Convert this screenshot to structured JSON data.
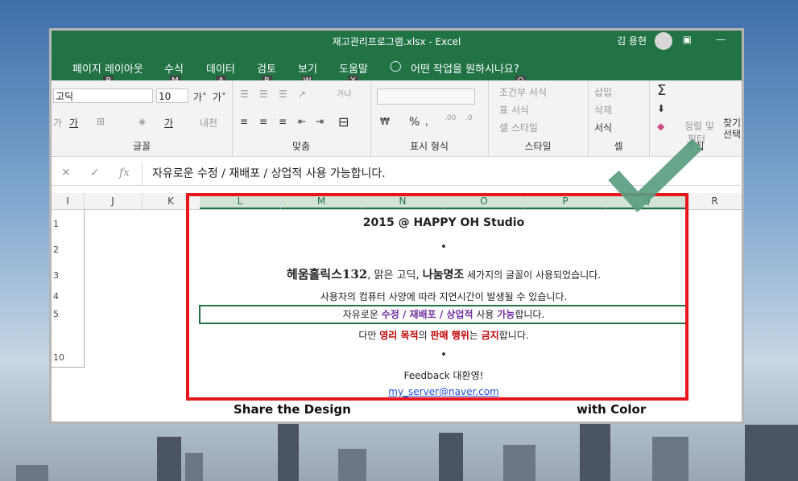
{
  "window": {
    "title": "재고관리프로그램.xlsx  -  Excel",
    "user": "김 용현"
  },
  "menu": [
    {
      "label": "페이지 레이아웃",
      "key": "P"
    },
    {
      "label": "수식",
      "key": "M"
    },
    {
      "label": "데이터",
      "key": "A"
    },
    {
      "label": "검토",
      "key": "R"
    },
    {
      "label": "보기",
      "key": "W"
    },
    {
      "label": "도움말",
      "key": "Y"
    }
  ],
  "tellme": {
    "label": "어떤 작업을 원하시나요?",
    "key": "Q"
  },
  "ribbon": {
    "font_name": "고딕",
    "font_size": "10",
    "groups": {
      "font": "글꼴",
      "alignment": "맞춤",
      "number": "표시 형식",
      "styles": "스타일",
      "cells": "셀",
      "editing": "편집"
    },
    "styles_items": [
      "조건부 서식",
      "표 서식",
      "셀 스타일"
    ],
    "cells_items": [
      "삽입",
      "삭제",
      "서식"
    ],
    "editing_items": [
      "정렬 및",
      "필터",
      "찾기",
      "선택"
    ],
    "percent": "%"
  },
  "formula_bar": {
    "fx": "fx",
    "content": "자유로운 수정 / 재배포 / 상업적 사용 가능합니다."
  },
  "columns": [
    "I",
    "J",
    "K",
    "L",
    "M",
    "N",
    "O",
    "P",
    "Q",
    "R"
  ],
  "rows": [
    "1",
    "2",
    "3",
    "4",
    "5",
    "10"
  ],
  "sheet": {
    "line1": "2015 @ HAPPY OH Studio",
    "bullet": "•",
    "line3_part1": "헤움홀릭스132",
    "line3_part2": ", 맑은 고딕, ",
    "line3_part3": "나눔명조",
    "line3_part4": " 세가지의 글꼴이 사용되었습니다.",
    "line4": "사용자의 컴퓨터 사양에 따라 지연시간이 발생될 수 있습니다.",
    "line5": [
      {
        "text": "자유로운 ",
        "style": "normal"
      },
      {
        "text": "수정 / 재배포 / 상업적",
        "style": "purple"
      },
      {
        "text": " 사용 ",
        "style": "normal"
      },
      {
        "text": "가능",
        "style": "purple"
      },
      {
        "text": "합니다.",
        "style": "normal"
      }
    ],
    "line6": [
      {
        "text": "다만 ",
        "style": "normal"
      },
      {
        "text": "영리 목적",
        "style": "red"
      },
      {
        "text": "의 ",
        "style": "normal"
      },
      {
        "text": "판매 행위",
        "style": "red"
      },
      {
        "text": "는 ",
        "style": "normal"
      },
      {
        "text": "금지",
        "style": "red"
      },
      {
        "text": "합니다.",
        "style": "normal"
      }
    ],
    "feedback": "Feedback 대환영!",
    "email": "my_server@naver.com"
  },
  "footer": {
    "left": "Share the Design",
    "right": "with Color"
  },
  "colors": {
    "excel_green": "#217346",
    "highlight_red": "#e8161c",
    "check_green": "#5a9e80"
  }
}
